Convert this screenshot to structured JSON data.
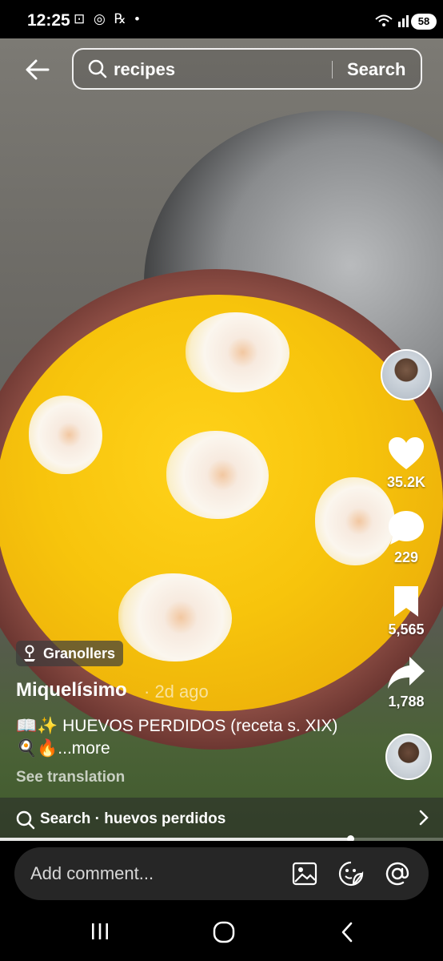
{
  "status_bar": {
    "time": "12:25",
    "left_icons": "⊡ ◎ ℞ •",
    "right_icons": "📶",
    "battery": "58"
  },
  "search": {
    "query": "recipes",
    "button": "Search"
  },
  "actions": {
    "likes": "35.2K",
    "comments": "229",
    "saves": "5,565",
    "shares": "1,788"
  },
  "post": {
    "location": "Granollers",
    "username": "Miquelísimo",
    "time_ago": "· 2d ago",
    "caption_line1": "📖✨ HUEVOS PERDIDOS (receta s. XIX)",
    "caption_line2": "🍳🔥",
    "caption_more": "...more",
    "see_translation": "See translation"
  },
  "suggestion": {
    "text": "Search · huevos perdidos"
  },
  "progress": {
    "fraction": 0.79
  },
  "comment": {
    "placeholder": "Add comment..."
  }
}
